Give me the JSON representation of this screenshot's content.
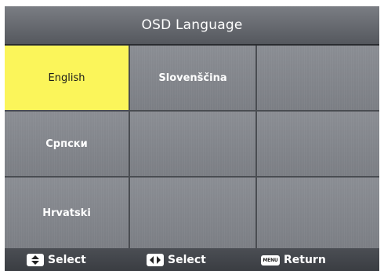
{
  "header": {
    "title": "OSD Language"
  },
  "languages": [
    {
      "label": "English",
      "selected": true
    },
    {
      "label": "Slovenščina",
      "selected": false
    },
    {
      "label": "",
      "selected": false
    },
    {
      "label": "Српски",
      "selected": false
    },
    {
      "label": "",
      "selected": false
    },
    {
      "label": "",
      "selected": false
    },
    {
      "label": "Hrvatski",
      "selected": false
    },
    {
      "label": "",
      "selected": false
    },
    {
      "label": "",
      "selected": false
    }
  ],
  "footer": {
    "hints": [
      {
        "icon": "up-down-arrows-icon",
        "label": "Select"
      },
      {
        "icon": "left-right-arrows-icon",
        "label": "Select"
      },
      {
        "icon": "menu-key-icon",
        "icon_text": "MENU",
        "label": "Return"
      }
    ]
  },
  "colors": {
    "selected_background": "#fbf55a",
    "cell_background": "#7f8288",
    "panel_background": "#5b5e64"
  }
}
